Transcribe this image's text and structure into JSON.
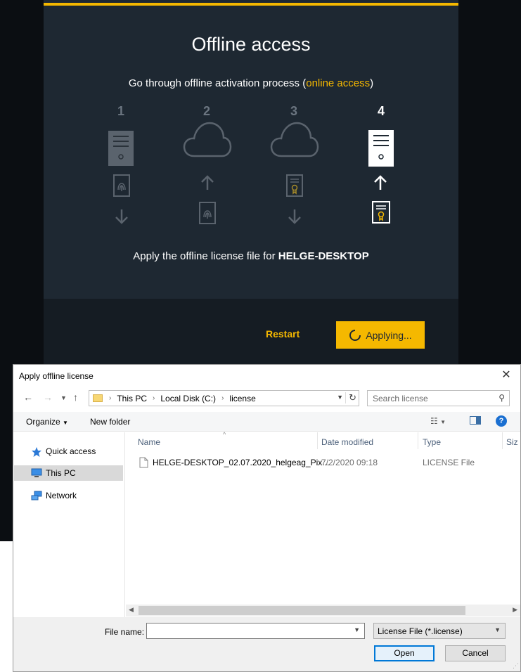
{
  "app": {
    "title": "Offline access",
    "subtitle_prefix": "Go through offline activation process (",
    "subtitle_link": "online access",
    "subtitle_suffix": ")",
    "steps": [
      {
        "number": "1"
      },
      {
        "number": "2"
      },
      {
        "number": "3"
      },
      {
        "number": "4"
      }
    ],
    "apply_text_prefix": "Apply the offline license file for ",
    "apply_text_machine": "HELGE-DESKTOP",
    "restart_label": "Restart",
    "applying_label": "Applying...",
    "colors": {
      "accent": "#f5b800",
      "panel": "#1e2832",
      "background": "#0b0e12"
    }
  },
  "dialog": {
    "title": "Apply offline license",
    "address": {
      "root": "This PC",
      "drive": "Local Disk (C:)",
      "folder": "license"
    },
    "search_placeholder": "Search license",
    "toolbar": {
      "organize": "Organize",
      "new_folder": "New folder"
    },
    "nav": [
      {
        "label": "Quick access",
        "icon": "star-icon"
      },
      {
        "label": "This PC",
        "icon": "computer-icon",
        "selected": true
      },
      {
        "label": "Network",
        "icon": "network-icon"
      }
    ],
    "columns": {
      "name": "Name",
      "date": "Date modified",
      "type": "Type",
      "size": "Siz"
    },
    "files": [
      {
        "name": "HELGE-DESKTOP_02.07.2020_helgeag_Pix...",
        "date": "7/2/2020 09:18",
        "type": "LICENSE File"
      }
    ],
    "file_name_label": "File name:",
    "file_name_value": "",
    "filter": "License File (*.license)",
    "open_label": "Open",
    "cancel_label": "Cancel"
  }
}
